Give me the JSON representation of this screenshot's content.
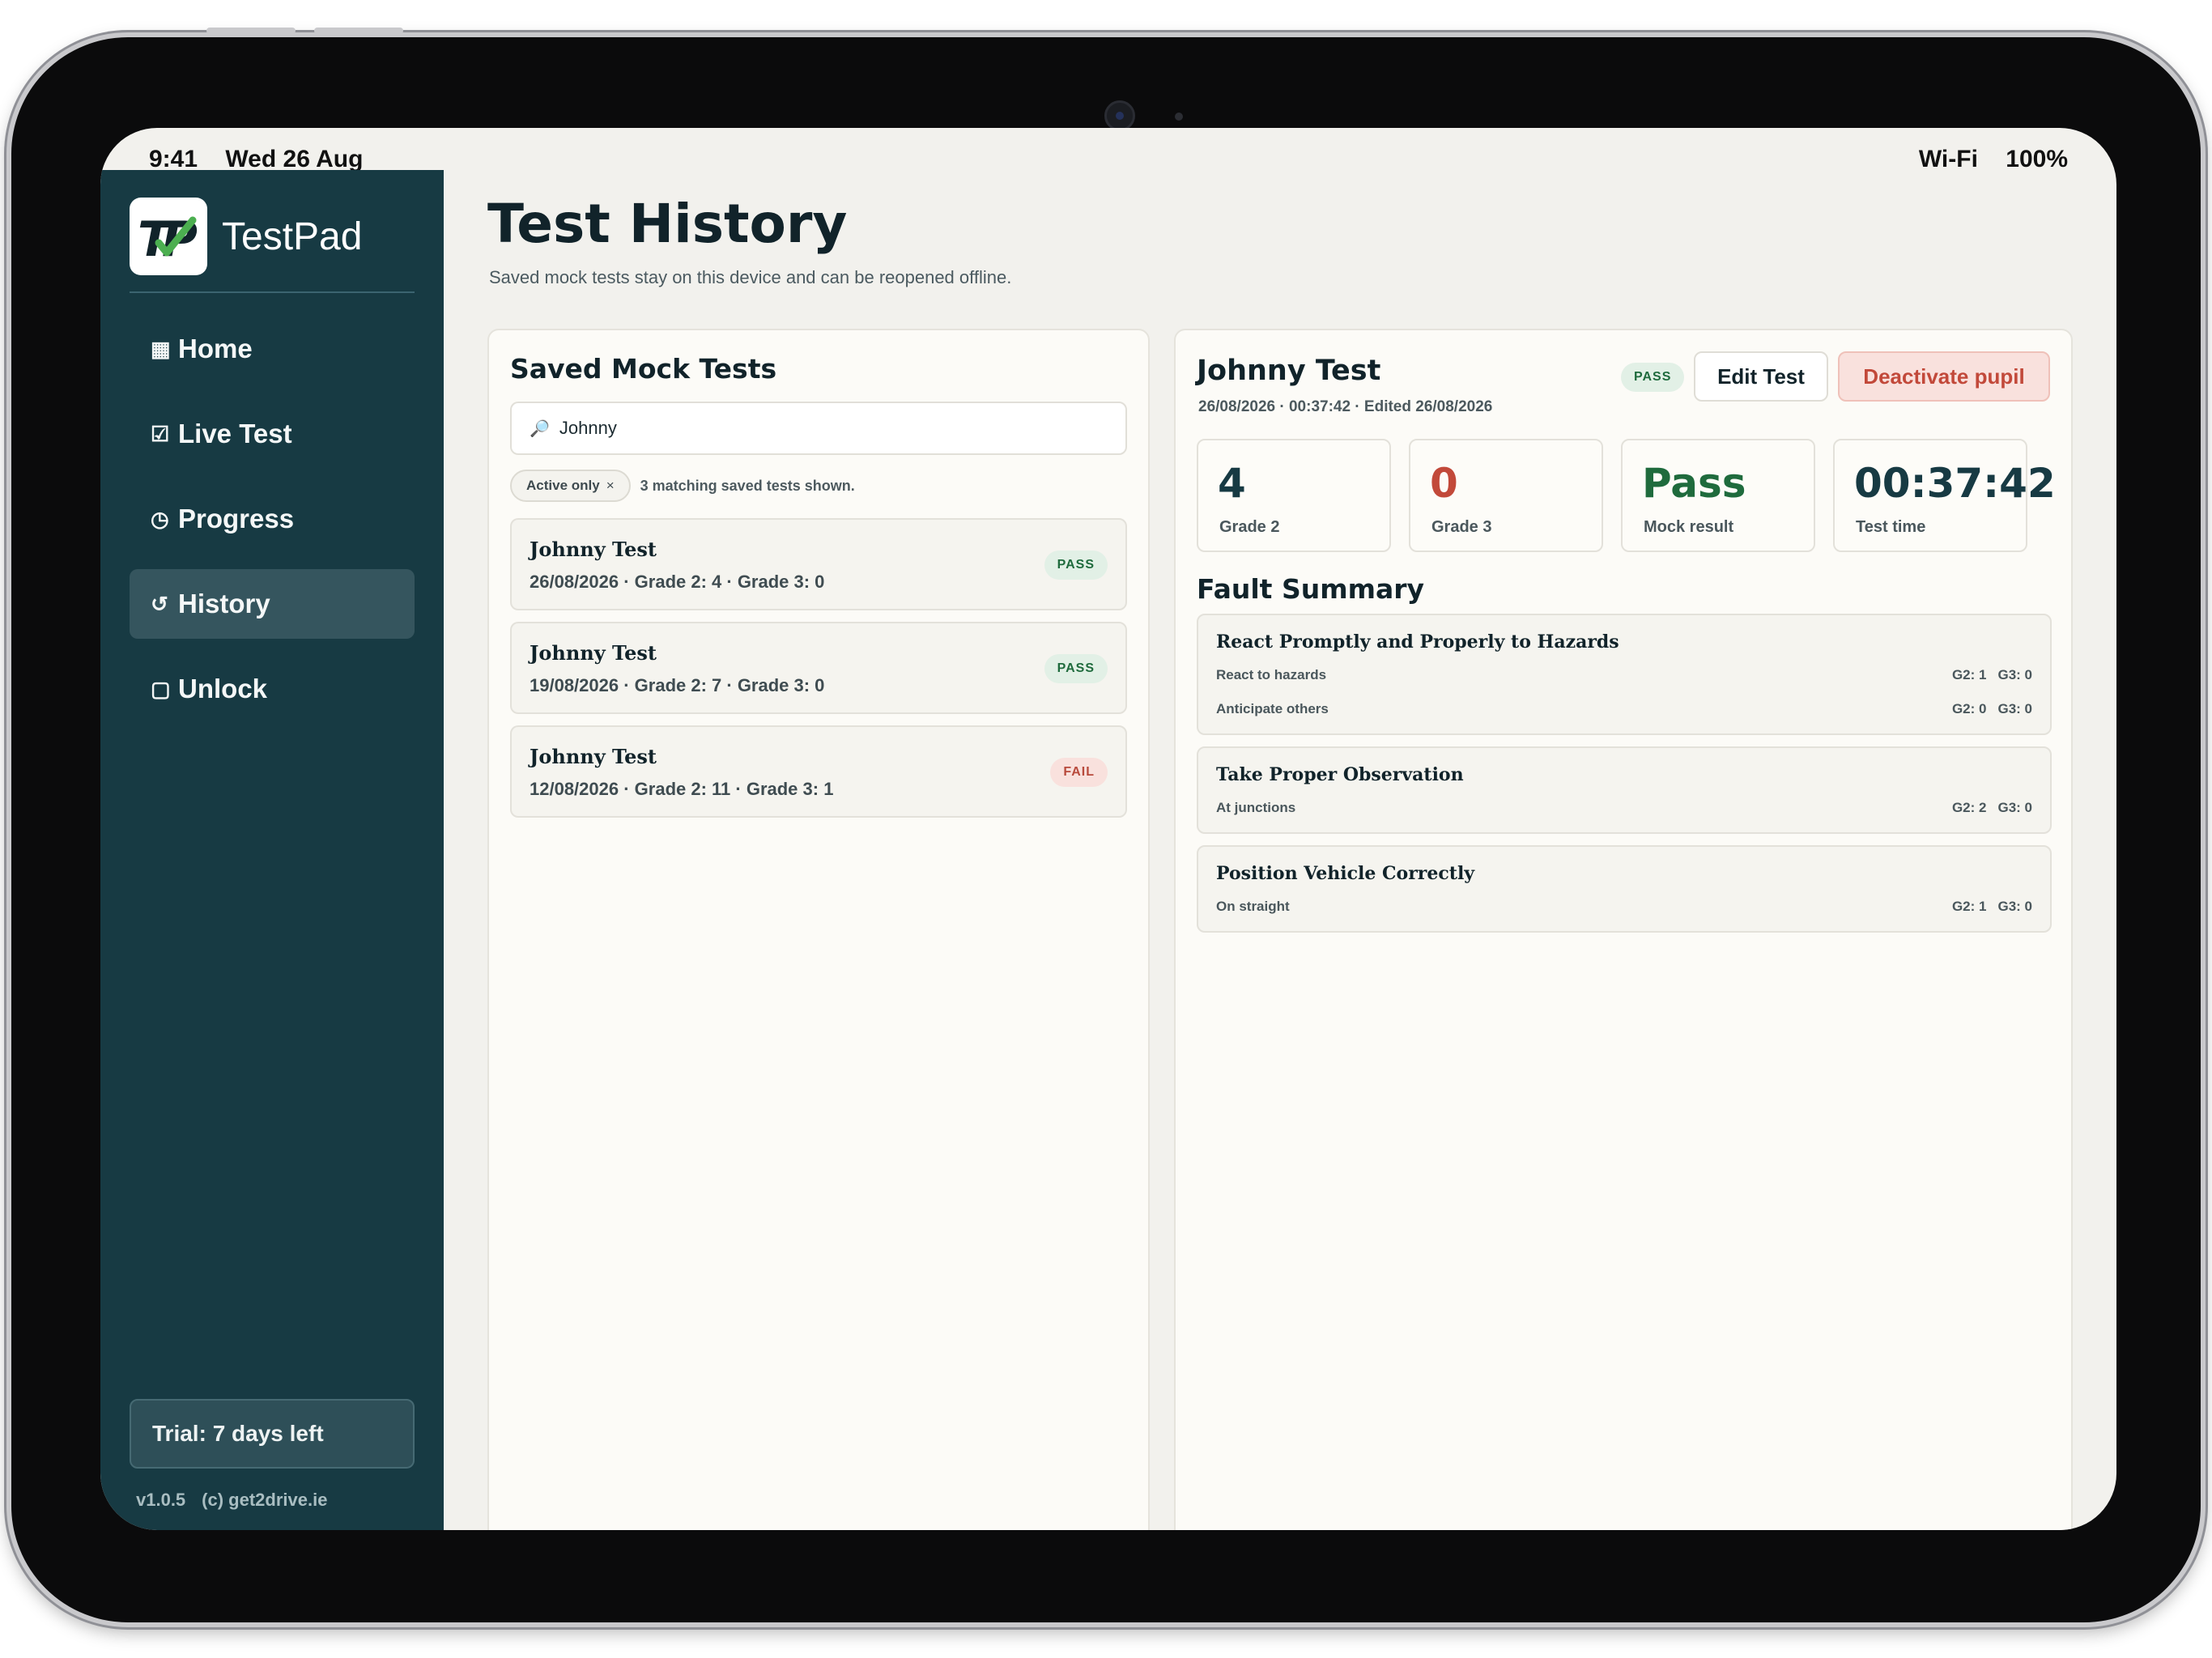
{
  "status_bar": {
    "time": "9:41",
    "date": "Wed 26 Aug",
    "wifi": "Wi-Fi",
    "battery": "100%"
  },
  "brand": {
    "name": "TestPad",
    "logo_text": "TP"
  },
  "nav": [
    {
      "icon": "▦",
      "label": "Home",
      "active": false
    },
    {
      "icon": "☑",
      "label": "Live Test",
      "active": false
    },
    {
      "icon": "◷",
      "label": "Progress",
      "active": false
    },
    {
      "icon": "↺",
      "label": "History",
      "active": true
    },
    {
      "icon": "▢",
      "label": "Unlock",
      "active": false
    }
  ],
  "trial": "Trial: 7 days left",
  "footer": {
    "version": "v1.0.5",
    "copyright": "(c) get2drive.ie"
  },
  "page": {
    "title": "Test History",
    "subtitle": "Saved mock tests stay on this device and can be reopened offline."
  },
  "saved_tests": {
    "heading": "Saved Mock Tests",
    "search_value": "Johnny",
    "filter_chip": "Active only",
    "filter_chip_close": "×",
    "match_count": "3 matching saved tests shown.",
    "items": [
      {
        "name": "Johnny Test",
        "meta": "26/08/2026 · Grade 2: 4 · Grade 3: 0",
        "result": "PASS"
      },
      {
        "name": "Johnny Test",
        "meta": "19/08/2026 · Grade 2: 7 · Grade 3: 0",
        "result": "PASS"
      },
      {
        "name": "Johnny Test",
        "meta": "12/08/2026 · Grade 2: 11 · Grade 3: 1",
        "result": "FAIL"
      }
    ]
  },
  "detail": {
    "name": "Johnny Test",
    "meta": "26/08/2026 · 00:37:42 · Edited 26/08/2026",
    "badge": "PASS",
    "edit_label": "Edit Test",
    "deactivate_label": "Deactivate pupil",
    "stats": [
      {
        "value": "4",
        "label": "Grade 2",
        "tone": "dark"
      },
      {
        "value": "0",
        "label": "Grade 3",
        "tone": "red"
      },
      {
        "value": "Pass",
        "label": "Mock result",
        "tone": "green"
      },
      {
        "value": "00:37:42",
        "label": "Test time",
        "tone": "dark"
      }
    ],
    "fault_heading": "Fault Summary",
    "faults": [
      {
        "title": "React Promptly and Properly to Hazards",
        "rows": [
          {
            "label": "React to hazards",
            "g2": "G2: 1",
            "g3": "G3: 0"
          },
          {
            "label": "Anticipate others",
            "g2": "G2: 0",
            "g3": "G3: 0"
          }
        ]
      },
      {
        "title": "Take Proper Observation",
        "rows": [
          {
            "label": "At junctions",
            "g2": "G2: 2",
            "g3": "G3: 0"
          }
        ]
      },
      {
        "title": "Position Vehicle Correctly",
        "rows": [
          {
            "label": "On straight",
            "g2": "G2: 1",
            "g3": "G3: 0"
          }
        ]
      }
    ]
  },
  "colors": {
    "sidebar": "#173a43",
    "accent_green": "#1f6b3d",
    "accent_red": "#c2493a",
    "background": "#f2f1ed"
  }
}
